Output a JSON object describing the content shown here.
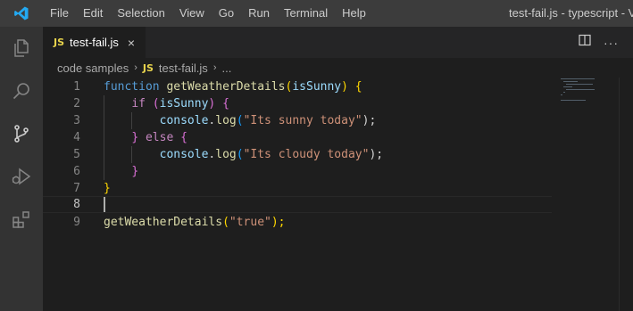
{
  "titlebar": {
    "menu": [
      "File",
      "Edit",
      "Selection",
      "View",
      "Go",
      "Run",
      "Terminal",
      "Help"
    ],
    "window_title": "test-fail.js - typescript - Visual"
  },
  "activitybar": {
    "icons": [
      "explorer-icon",
      "search-icon",
      "source-control-icon",
      "run-debug-icon",
      "extensions-icon"
    ]
  },
  "tab": {
    "badge": "JS",
    "label": "test-fail.js",
    "close": "×"
  },
  "tab_actions": {
    "split": "split-editor-icon",
    "more": "···"
  },
  "breadcrumb": {
    "folder": "code samples",
    "sep": "›",
    "badge": "JS",
    "file": "test-fail.js",
    "more": "..."
  },
  "editor": {
    "line_numbers": [
      "1",
      "2",
      "3",
      "4",
      "5",
      "6",
      "7",
      "8",
      "9"
    ],
    "active_line": "8",
    "lines": {
      "l1": {
        "kw": "function",
        "fn": "getWeatherDetails",
        "open": "(",
        "param": "isSunny",
        "close": ")",
        "brace": "{"
      },
      "l2": {
        "kw": "if",
        "open": "(",
        "param": "isSunny",
        "close": ")",
        "brace": "{"
      },
      "l3": {
        "obj": "console",
        "dot": ".",
        "fn": "log",
        "open": "(",
        "str": "\"Its sunny today\"",
        "close": ");"
      },
      "l4": {
        "brace": "}",
        "kw": "else",
        "brace2": "{"
      },
      "l5": {
        "obj": "console",
        "dot": ".",
        "fn": "log",
        "open": "(",
        "str": "\"Its cloudy today\"",
        "close": ");"
      },
      "l6": {
        "brace": "}"
      },
      "l7": {
        "brace": "}"
      },
      "l9": {
        "fn": "getWeatherDetails",
        "open": "(",
        "str": "\"true\"",
        "close": ");"
      }
    }
  },
  "colors": {
    "titlebar": "#3c3c3c",
    "activitybar": "#333333",
    "editor_bg": "#1e1e1e",
    "keyword": "#569cd6",
    "control": "#c586c0",
    "function": "#dcdcaa",
    "variable": "#9cdcfe",
    "string": "#ce9178"
  }
}
